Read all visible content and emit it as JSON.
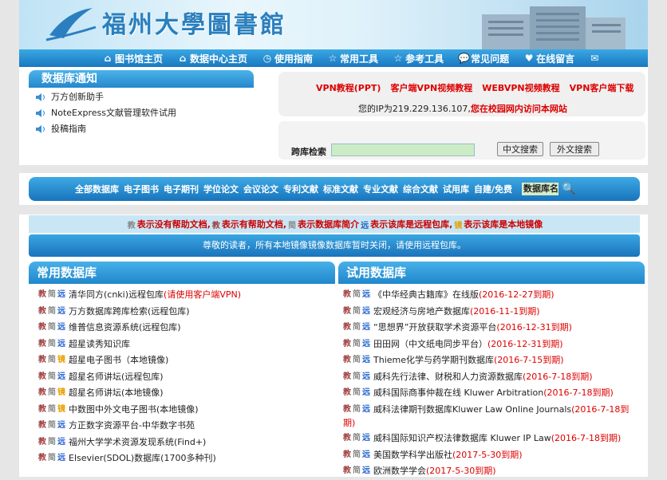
{
  "header": {
    "site_title": "福州大學圖書館"
  },
  "nav": [
    {
      "icon": "home-icon",
      "label": "图书馆主页"
    },
    {
      "icon": "home-icon",
      "label": "数据中心主页"
    },
    {
      "icon": "guide-icon",
      "label": "使用指南"
    },
    {
      "icon": "star-icon",
      "label": "常用工具"
    },
    {
      "icon": "star-icon",
      "label": "参考工具"
    },
    {
      "icon": "chat-icon",
      "label": "常见问题"
    },
    {
      "icon": "heart-icon",
      "label": "在线留言"
    },
    {
      "icon": "mail-icon",
      "label": ""
    }
  ],
  "notice": {
    "title": "数据库通知",
    "items": [
      "万方创新助手",
      "NoteExpress文献管理软件试用",
      "投稿指南"
    ]
  },
  "vpn": {
    "links": [
      "VPN教程(PPT)",
      "客户端VPN视频教程",
      "WEBVPN视频教程",
      "VPN客户端下载"
    ],
    "ip_prefix": "您的IP为219.229.136.107,",
    "ip_status": "您在校园网内访问本网站"
  },
  "search": {
    "label": "跨库检索",
    "value": "",
    "btn_cn": "中文搜索",
    "btn_en": "外文搜索"
  },
  "categories": [
    "全部数据库",
    "电子图书",
    "电子期刊",
    "学位论文",
    "会议论文",
    "专利文献",
    "标准文献",
    "专业文献",
    "综合文献",
    "试用库",
    "自建/免费"
  ],
  "dbname_input": "数据库名",
  "legend": {
    "jiao": "教",
    "t1": "表示没有帮助文档,",
    "jiao2": "教",
    "t2": "表示有帮助文档,",
    "jian": "简",
    "t3": "表示数据库简介",
    "yuan": "远",
    "t4": "表示该库是远程包库,",
    "jing": "镜",
    "t5": "表示该库是本地镜像"
  },
  "notice_bar": "尊敬的读者，所有本地镜像镜像数据库暂时关闭，请使用远程包库。",
  "common": {
    "title": "常用数据库",
    "rows": [
      {
        "tags": [
          "教",
          "简",
          "远"
        ],
        "name": "清华同方(cnki)远程包库",
        "extra": "(请使用客户端VPN)"
      },
      {
        "tags": [
          "教",
          "简",
          "远"
        ],
        "name": "万方数据库跨库检索(远程包库)",
        "extra": ""
      },
      {
        "tags": [
          "教",
          "简",
          "远"
        ],
        "name": "维普信息资源系统(远程包库)",
        "extra": ""
      },
      {
        "tags": [
          "教",
          "简",
          "远"
        ],
        "name": "超星读秀知识库",
        "extra": ""
      },
      {
        "tags": [
          "教",
          "简",
          "镜"
        ],
        "name": "超星电子图书（本地镜像)",
        "extra": ""
      },
      {
        "tags": [
          "教",
          "简",
          "远"
        ],
        "name": "超星名师讲坛(远程包库)",
        "extra": ""
      },
      {
        "tags": [
          "教",
          "简",
          "镜"
        ],
        "name": "超星名师讲坛(本地镜像)",
        "extra": ""
      },
      {
        "tags": [
          "教",
          "简",
          "镜"
        ],
        "name": "中数图中外文电子图书(本地镜像)",
        "extra": ""
      },
      {
        "tags": [
          "教",
          "简",
          "远"
        ],
        "name": "方正数字资源平台-中华数字书苑",
        "extra": ""
      },
      {
        "tags": [
          "教",
          "简",
          "远"
        ],
        "name": "福州大学学术资源发现系统(Find+)",
        "extra": ""
      },
      {
        "tags": [
          "教",
          "简",
          "远"
        ],
        "name": "Elsevier(SDOL)数据库(1700多种刊)",
        "extra": ""
      }
    ]
  },
  "trial": {
    "title": "试用数据库",
    "rows": [
      {
        "tags": [
          "教",
          "简",
          "远"
        ],
        "name": "《中华经典古籍库》在线版",
        "extra": "(2016-12-27到期)"
      },
      {
        "tags": [
          "教",
          "简",
          "远"
        ],
        "name": "宏观经济与房地产数据库",
        "extra": "(2016-11-1到期)"
      },
      {
        "tags": [
          "教",
          "简",
          "远"
        ],
        "name": "“思想界”开放获取学术资源平台",
        "extra": "(2016-12-31到期)"
      },
      {
        "tags": [
          "教",
          "简",
          "远"
        ],
        "name": "田田网（中文纸电同步平台）",
        "extra": "(2016-12-31到期)"
      },
      {
        "tags": [
          "教",
          "简",
          "远"
        ],
        "name": "Thieme化学与药学期刊数据库",
        "extra": "(2016-7-15到期)"
      },
      {
        "tags": [
          "教",
          "简",
          "远"
        ],
        "name": "威科先行法律、财税和人力资源数据库",
        "extra": "(2016-7-18到期)"
      },
      {
        "tags": [
          "教",
          "简",
          "远"
        ],
        "name": "威科国际商事仲裁在线 Kluwer Arbitration",
        "extra": "(2016-7-18到期)"
      },
      {
        "tags": [
          "教",
          "简",
          "远"
        ],
        "name": "威科法律期刊数据库Kluwer Law Online Journals",
        "extra": "(2016-7-18到"
      },
      {
        "tags": [
          "教",
          "简",
          "远"
        ],
        "name": "威科国际知识产权法律数据库 Kluwer IP Law",
        "extra": "(2016-7-18到期)"
      },
      {
        "tags": [
          "教",
          "简",
          "远"
        ],
        "name": "美国数学科学出版社",
        "extra": "(2017-5-30到期)"
      },
      {
        "tags": [
          "教",
          "简",
          "远"
        ],
        "name": "欧洲数学学会",
        "extra": "(2017-5-30到期)"
      }
    ],
    "wrap_tail": "期)"
  }
}
